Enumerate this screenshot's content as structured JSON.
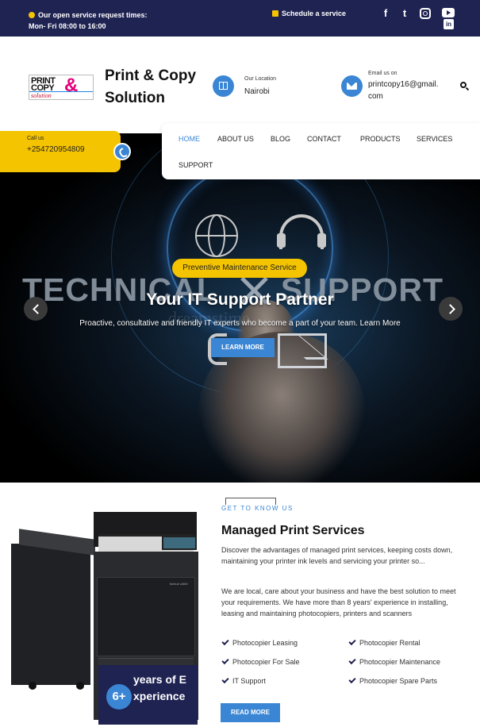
{
  "topbar": {
    "hours_title": "Our open service request times:",
    "hours_value": "Mon- Fri 08:00 to 16:00",
    "schedule_label": "Schedule a service",
    "social_icons": [
      "facebook-icon",
      "twitter-icon",
      "instagram-icon",
      "youtube-icon",
      "linkedin-icon"
    ],
    "background_color": "#1f2352"
  },
  "header": {
    "logo": {
      "line1": "PRINT",
      "line2": "COPY",
      "amp": "&",
      "line3": "solution"
    },
    "brand_name": "Print & Copy Solution",
    "location_label": "Our Location",
    "location_value": "Nairobi",
    "email_label": "Email us on",
    "email_value": "printcopy16@gmail.com",
    "call_label": "Call us",
    "call_value": "+254720954809"
  },
  "nav": {
    "items": [
      "HOME",
      "ABOUT US",
      "BLOG",
      "CONTACT",
      "PRODUCTS",
      "SERVICES",
      "SUPPORT"
    ],
    "active": "HOME"
  },
  "hero": {
    "image_text": [
      "TECHNICAL",
      "SUPPORT"
    ],
    "watermark": "dreamstime",
    "badge": "Preventive Maintenance Service",
    "title": "Your IT Support Partner",
    "subtitle": "Proactive, consultative and friendly IT experts who become a part of your team. Learn More",
    "button_label": "LEARN MORE"
  },
  "about": {
    "eyebrow": "GET TO KNOW US",
    "title": "Managed Print Services",
    "paragraph1": "Discover the advantages of managed print services, keeping costs down, maintaining your printer ink levels and servicing your printer so...",
    "paragraph2": "We are local, care about your business and have the best solution to meet your requirements. We have more than 8 years' experience in installing, leasing and maintaining photocopiers, printers and scanners",
    "features": [
      "Photocopier Leasing",
      "Photocopier Rental",
      "Photocopier For Sale",
      "Photocopier Maintenance",
      "IT Support",
      "Photocopier Spare Parts"
    ],
    "experience_number": "6+",
    "experience_text": "years of Experience",
    "printer_label": "bizhub c360i",
    "read_more_label": "READ MORE"
  },
  "colors": {
    "accent_blue": "#3a86d4",
    "accent_yellow": "#f5c400",
    "navy": "#1f2352"
  }
}
